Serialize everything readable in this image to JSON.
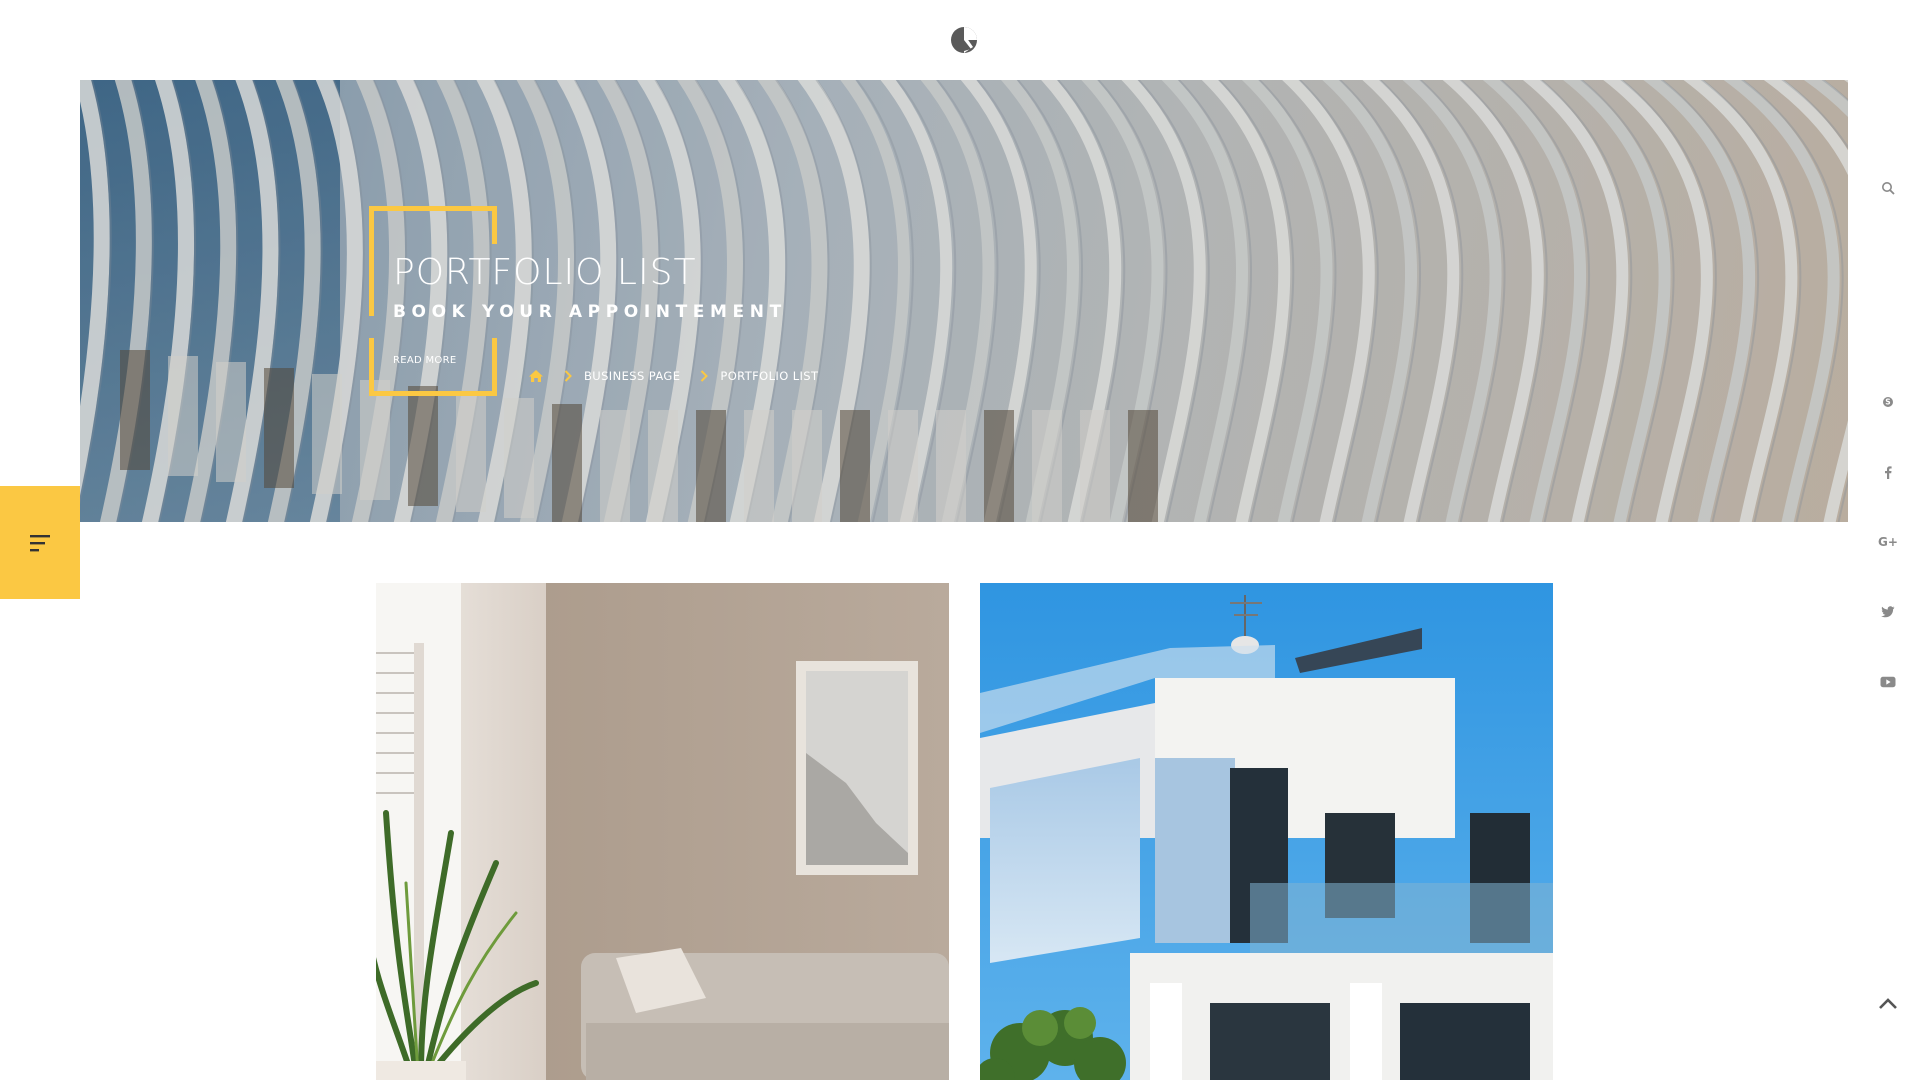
{
  "header": {
    "logo_icon": "site-logo-icon"
  },
  "hero": {
    "title": "PORTFOLIO LIST",
    "subtitle": "BOOK YOUR APPOINTEMENT",
    "read_more": "READ MORE",
    "breadcrumb": {
      "home_icon": "home-icon",
      "items": [
        "BUSINESS PAGE",
        "PORTFOLIO LIST"
      ]
    }
  },
  "side_menu": {
    "icon": "menu-lines-icon"
  },
  "right_rail": {
    "icons": [
      "search-icon",
      "skype-icon",
      "facebook-icon",
      "google-plus-icon",
      "twitter-icon",
      "youtube-icon",
      "scroll-top-icon"
    ],
    "google_plus_text": "G+"
  },
  "portfolio": {
    "items": [
      {
        "image": "interior-living-room-image"
      },
      {
        "image": "modern-white-house-image"
      }
    ]
  },
  "colors": {
    "accent": "#fbc843",
    "text_light": "#ffffff",
    "icon_gray": "#8a8a8a"
  }
}
